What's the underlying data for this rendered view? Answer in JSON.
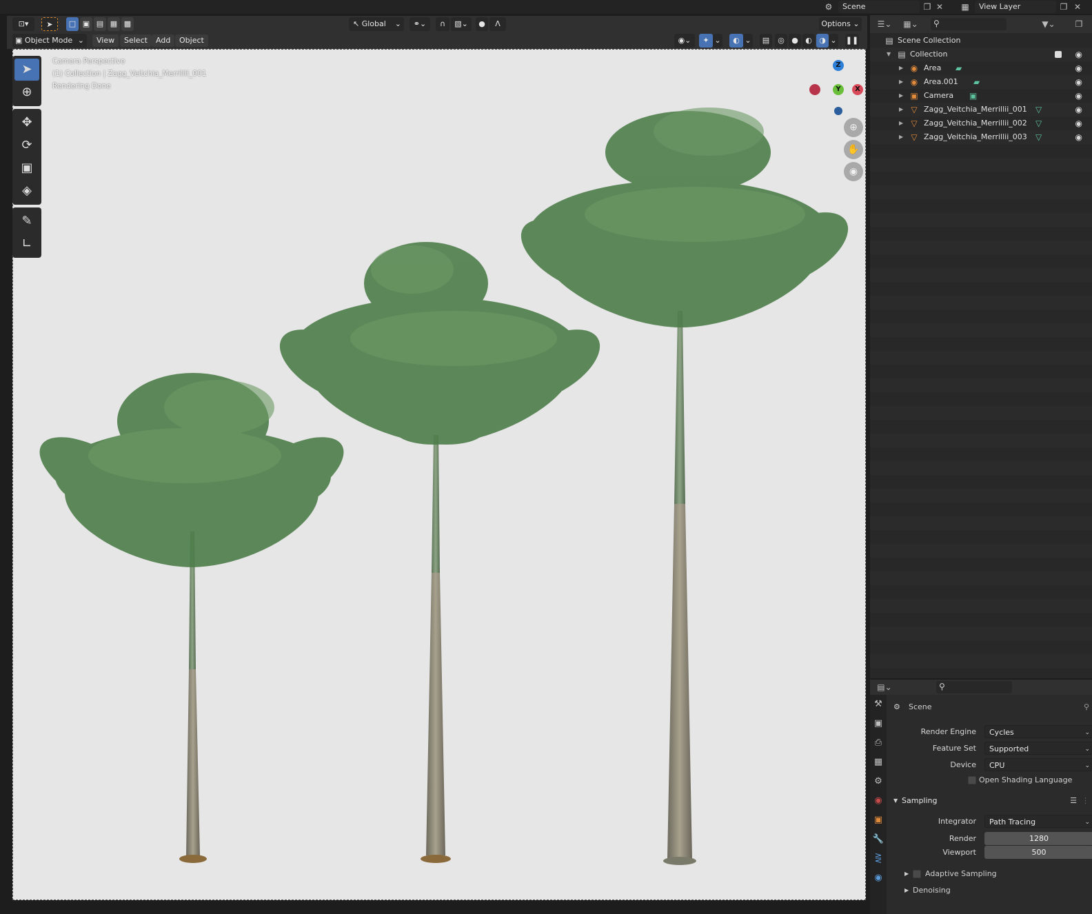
{
  "topbar": {
    "scene_icon": "scene-icon",
    "scene_name": "Scene",
    "view_layer_name": "View Layer"
  },
  "viewport_header": {
    "orientation": "Global",
    "options_label": "Options",
    "mode_label": "Object Mode",
    "menus": [
      "View",
      "Select",
      "Add",
      "Object"
    ]
  },
  "viewport": {
    "overlay_lines": [
      "Camera Perspective",
      "(1) Collection | Zagg_Veitchia_Merrillii_001",
      "Rendering Done"
    ],
    "gizmo": {
      "z": "Z",
      "y": "Y",
      "x": "X"
    },
    "colors": {
      "background": "#e6e6e6",
      "foliage": "#4e7d4a",
      "trunk": "#8a8574"
    }
  },
  "outliner": {
    "scene_collection": "Scene Collection",
    "items": [
      {
        "label": "Collection",
        "icon": "collection-icon"
      },
      {
        "label": "Area",
        "icon": "light-icon"
      },
      {
        "label": "Area.001",
        "icon": "light-icon"
      },
      {
        "label": "Camera",
        "icon": "camera-icon"
      },
      {
        "label": "Zagg_Veitchia_Merrillii_001",
        "icon": "mesh-icon"
      },
      {
        "label": "Zagg_Veitchia_Merrillii_002",
        "icon": "mesh-icon"
      },
      {
        "label": "Zagg_Veitchia_Merrillii_003",
        "icon": "mesh-icon"
      }
    ]
  },
  "properties": {
    "context": "Scene",
    "render_engine_label": "Render Engine",
    "render_engine": "Cycles",
    "feature_set_label": "Feature Set",
    "feature_set": "Supported",
    "device_label": "Device",
    "device": "CPU",
    "osl_label": "Open Shading Language",
    "sampling_label": "Sampling",
    "integrator_label": "Integrator",
    "integrator": "Path Tracing",
    "render_label": "Render",
    "render_samples": "1280",
    "viewport_label": "Viewport",
    "viewport_samples": "500",
    "adaptive_label": "Adaptive Sampling",
    "denoising_label": "Denoising"
  }
}
